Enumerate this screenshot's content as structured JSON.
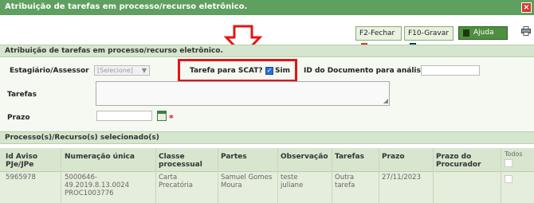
{
  "window": {
    "title": "Atribuição de tarefas em processo/recurso eletrônico.",
    "close_glyph": "×"
  },
  "toolbar": {
    "fechar_label": "F2-Fechar",
    "gravar_label": "F10-Gravar",
    "ajuda_label": "Ajuda"
  },
  "section1": {
    "title": "Atribuição de tarefas em processo/recurso eletrônico."
  },
  "form": {
    "estagiario_label": "Estagiário/Assessor",
    "estagiario_selected": "[Selecione]",
    "tarefa_scat_label": "Tarefa para SCAT?",
    "sim_label": "Sim",
    "sim_checked": true,
    "id_doc_label": "ID do Documento para análise",
    "id_doc_value": "",
    "tarefas_label": "Tarefas",
    "tarefas_value": "",
    "prazo_label": "Prazo",
    "prazo_value": "",
    "required_mark": "*"
  },
  "section2": {
    "title": "Processo(s)/Recurso(s) selecionado(s)"
  },
  "table": {
    "headers": {
      "id_aviso_1": "Id Aviso",
      "id_aviso_2": "PJe/JPe",
      "numeracao": "Numeração única",
      "classe_1": "Classe",
      "classe_2": "processual",
      "partes": "Partes",
      "observacao": "Observação",
      "tarefas": "Tarefas",
      "prazo": "Prazo",
      "prazo_proc_1": "Prazo do",
      "prazo_proc_2": "Procurador",
      "todos": "Todos"
    },
    "rows": [
      {
        "id_aviso": "5965978",
        "numeracao_1": "5000646-",
        "numeracao_2": "49.2019.8.13.0024",
        "numeracao_3": "PROC1003776",
        "classe_1": "Carta",
        "classe_2": "Precatória",
        "partes_1": "Samuel Gomes",
        "partes_2": "Moura",
        "observacao_1": "teste",
        "observacao_2": "juliane",
        "tarefas_1": "Outra",
        "tarefas_2": "tarefa",
        "prazo": "27/11/2023",
        "prazo_procurador": ""
      }
    ]
  }
}
